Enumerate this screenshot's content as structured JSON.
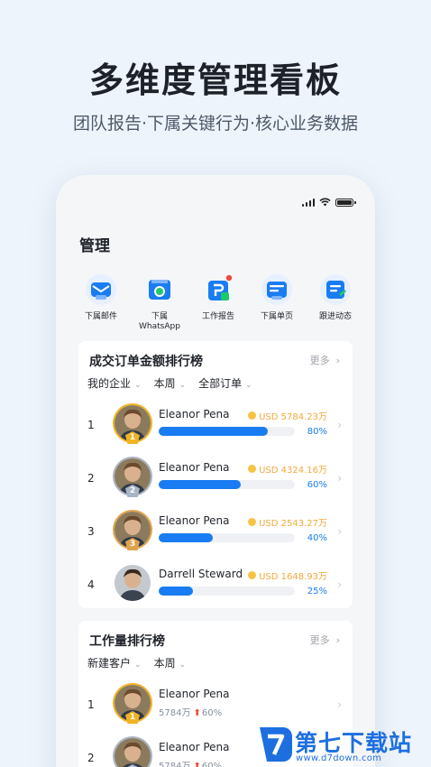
{
  "hero": {
    "title": "多维度管理看板",
    "subtitle": "团队报告·下属关键行为·核心业务数据"
  },
  "page": {
    "title": "管理"
  },
  "quick_actions": [
    {
      "label": "下属邮件",
      "icon": "mail-icon",
      "color": "#1a7cf2"
    },
    {
      "label": "下属\nWhatsApp",
      "icon": "whatsapp-icon",
      "color": "#1a7cf2"
    },
    {
      "label": "工作报告",
      "icon": "report-icon",
      "color": "#1a7cf2",
      "badge": true
    },
    {
      "label": "下属单页",
      "icon": "page-icon",
      "color": "#1a7cf2"
    },
    {
      "label": "跟进动态",
      "icon": "follow-up-icon",
      "color": "#1a7cf2"
    }
  ],
  "deals_ranking": {
    "title": "成交订单金额排行榜",
    "more_label": "更多",
    "filters": [
      "我的企业",
      "本周",
      "全部订单"
    ],
    "rows": [
      {
        "rank": "1",
        "name": "Eleanor Pena",
        "amount": "USD 5784.23万",
        "percent": "80%",
        "value": 0.8,
        "medal_color": "#f0b323"
      },
      {
        "rank": "2",
        "name": "Eleanor Pena",
        "amount": "USD 4324.16万",
        "percent": "60%",
        "value": 0.6,
        "medal_color": "#a9b4c4"
      },
      {
        "rank": "3",
        "name": "Eleanor Pena",
        "amount": "USD 2543.27万",
        "percent": "40%",
        "value": 0.4,
        "medal_color": "#e0a34a"
      },
      {
        "rank": "4",
        "name": "Darrell Steward",
        "amount": "USD 1648.93万",
        "percent": "25%",
        "value": 0.25,
        "medal_color": ""
      }
    ]
  },
  "work_ranking": {
    "title": "工作量排行榜",
    "more_label": "更多",
    "filters": [
      "新建客户",
      "本周"
    ],
    "rows": [
      {
        "rank": "1",
        "name": "Eleanor Pena",
        "count": "5784万",
        "change": "60%",
        "medal_color": "#f0b323"
      },
      {
        "rank": "2",
        "name": "Eleanor Pena",
        "count": "5784万",
        "change": "60%",
        "medal_color": "#a9b4c4"
      }
    ]
  },
  "watermark": {
    "main": "第七下载站",
    "url": "www.d7down.com"
  },
  "colors": {
    "accent": "#1a7cf2",
    "gold": "#f2a93b",
    "up": "#e8433a"
  }
}
